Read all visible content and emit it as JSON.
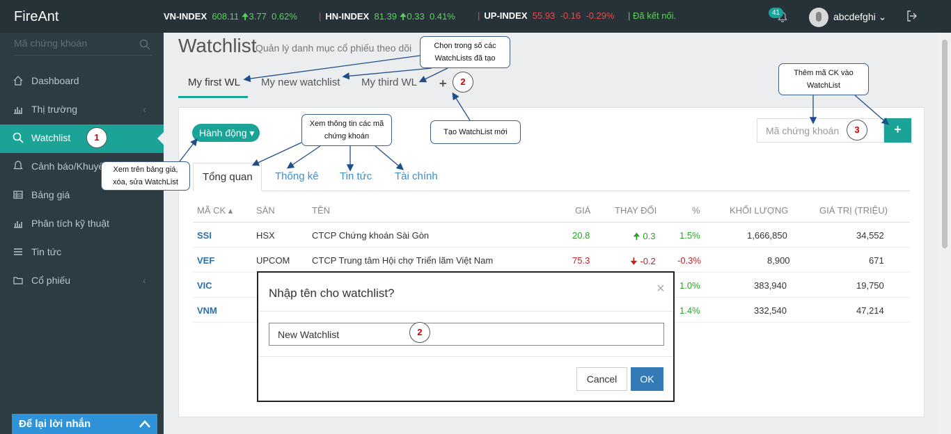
{
  "topbar": {
    "logo": "FireAnt",
    "indices": [
      {
        "name": "VN-INDEX",
        "value": "608.11",
        "change": "3.77",
        "pct": "0.62%",
        "dir": "up"
      },
      {
        "name": "HN-INDEX",
        "value": "81.39",
        "change": "0.33",
        "pct": "0.41%",
        "dir": "up"
      },
      {
        "name": "UP-INDEX",
        "value": "55.93",
        "change": "-0.16",
        "pct": "-0.29%",
        "dir": "down"
      }
    ],
    "status": "Đã kết nối.",
    "notif_count": "41",
    "username": "abcdefghi"
  },
  "sidebar": {
    "search_placeholder": "Mã chứng khoán",
    "items": [
      {
        "label": "Dashboard",
        "icon": "home-icon"
      },
      {
        "label": "Thị trường",
        "icon": "bar-chart-icon"
      },
      {
        "label": "Watchlist",
        "icon": "search-icon"
      },
      {
        "label": "Cảnh báo/Khuyến nghị",
        "icon": "bell-icon"
      },
      {
        "label": "Bảng giá",
        "icon": "table-icon"
      },
      {
        "label": "Phân tích kỹ thuật",
        "icon": "bar-chart-icon"
      },
      {
        "label": "Tin tức",
        "icon": "list-icon"
      },
      {
        "label": "Cổ phiếu",
        "icon": "folder-icon"
      }
    ],
    "leave_message": "Để lại lời nhắn"
  },
  "page": {
    "title": "Watchlist",
    "subtitle": "Quản lý danh mục cổ phiếu theo dõi"
  },
  "watchlists": {
    "tabs": [
      "My first WL",
      "My new watchlist",
      "My third WL"
    ],
    "add_label": "+"
  },
  "toolbar": {
    "action_label": "Hành động",
    "code_placeholder": "Mã chứng khoán",
    "add_label": "+"
  },
  "info_tabs": [
    "Tổng quan",
    "Thống kê",
    "Tin tức",
    "Tài chính"
  ],
  "table": {
    "headers": [
      "MÃ CK",
      "SÀN",
      "TÊN",
      "GIÁ",
      "THAY ĐỔI",
      "%",
      "KHỐI LƯỢNG",
      "GIÁ TRỊ (TRIỆU)"
    ],
    "rows": [
      {
        "code": "SSI",
        "exchange": "HSX",
        "name": "CTCP Chứng khoán Sài Gòn",
        "price": "20.8",
        "change": "0.3",
        "pct": "1.5%",
        "volume": "1,666,850",
        "value": "34,552",
        "dir": "up"
      },
      {
        "code": "VEF",
        "exchange": "UPCOM",
        "name": "CTCP Trung tâm Hội chợ Triển lãm Việt Nam",
        "price": "75.3",
        "change": "-0.2",
        "pct": "-0.3%",
        "volume": "8,900",
        "value": "671",
        "dir": "down"
      },
      {
        "code": "VIC",
        "exchange": "",
        "name": "",
        "price": "",
        "change": "",
        "pct": "1.0%",
        "volume": "383,940",
        "value": "19,750",
        "dir": "up"
      },
      {
        "code": "VNM",
        "exchange": "",
        "name": "",
        "price": "",
        "change": "",
        "pct": "1.4%",
        "volume": "332,540",
        "value": "47,214",
        "dir": "up"
      }
    ]
  },
  "modal": {
    "title": "Nhập tên cho watchlist?",
    "input_value": "New Watchlist",
    "cancel_label": "Cancel",
    "ok_label": "OK",
    "close_glyph": "×"
  },
  "callouts": {
    "choose_wl": [
      "Chọn trong số các",
      "WatchLists đã tạo"
    ],
    "add_code": [
      "Thêm mã CK vào",
      "WatchList"
    ],
    "stock_info": [
      "Xem thông tin các mã",
      "chứng khoán"
    ],
    "new_wl": "Tạo WatchList mới",
    "view_board": [
      "Xem trên bảng giá,",
      "xóa, sửa WatchList"
    ]
  },
  "markers": [
    "1",
    "2",
    "2",
    "3"
  ],
  "colors": {
    "accent": "#1ba398",
    "sidebar_bg": "#2d3b42",
    "topbar_bg": "#273238",
    "up": "#27a327",
    "down": "#c32121",
    "link": "#2e6ea8",
    "primary": "#337ab7"
  }
}
